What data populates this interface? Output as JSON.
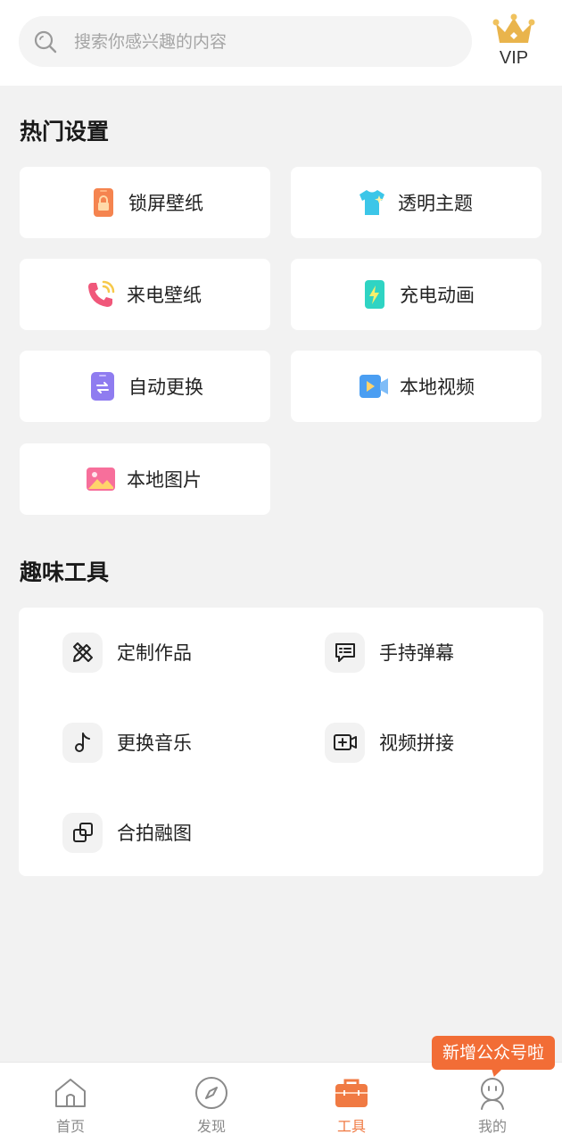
{
  "search": {
    "placeholder": "搜索你感兴趣的内容",
    "icon": "search-icon"
  },
  "vip": {
    "label": "VIP",
    "icon": "crown-icon",
    "color": "#e9b44c"
  },
  "hot_settings": {
    "title": "热门设置",
    "items": [
      {
        "label": "锁屏壁纸",
        "icon": "lock-phone-icon"
      },
      {
        "label": "透明主题",
        "icon": "tshirt-icon"
      },
      {
        "label": "来电壁纸",
        "icon": "phone-call-icon"
      },
      {
        "label": "充电动画",
        "icon": "charging-battery-icon"
      },
      {
        "label": "自动更换",
        "icon": "auto-switch-icon"
      },
      {
        "label": "本地视频",
        "icon": "video-icon"
      },
      {
        "label": "本地图片",
        "icon": "image-icon"
      }
    ]
  },
  "fun_tools": {
    "title": "趣味工具",
    "items": [
      {
        "label": "定制作品",
        "icon": "pencil-ruler-icon"
      },
      {
        "label": "手持弹幕",
        "icon": "message-icon"
      },
      {
        "label": "更换音乐",
        "icon": "music-note-icon"
      },
      {
        "label": "视频拼接",
        "icon": "video-add-icon"
      },
      {
        "label": "合拍融图",
        "icon": "layers-icon"
      }
    ]
  },
  "tabbar": {
    "active": "工具",
    "active_color": "#f07a43",
    "items": [
      {
        "label": "首页",
        "icon": "home-icon"
      },
      {
        "label": "发现",
        "icon": "compass-icon"
      },
      {
        "label": "工具",
        "icon": "toolbox-icon"
      },
      {
        "label": "我的",
        "icon": "profile-icon"
      }
    ]
  },
  "tooltip": {
    "text": "新增公众号啦",
    "color": "#f26d36"
  }
}
